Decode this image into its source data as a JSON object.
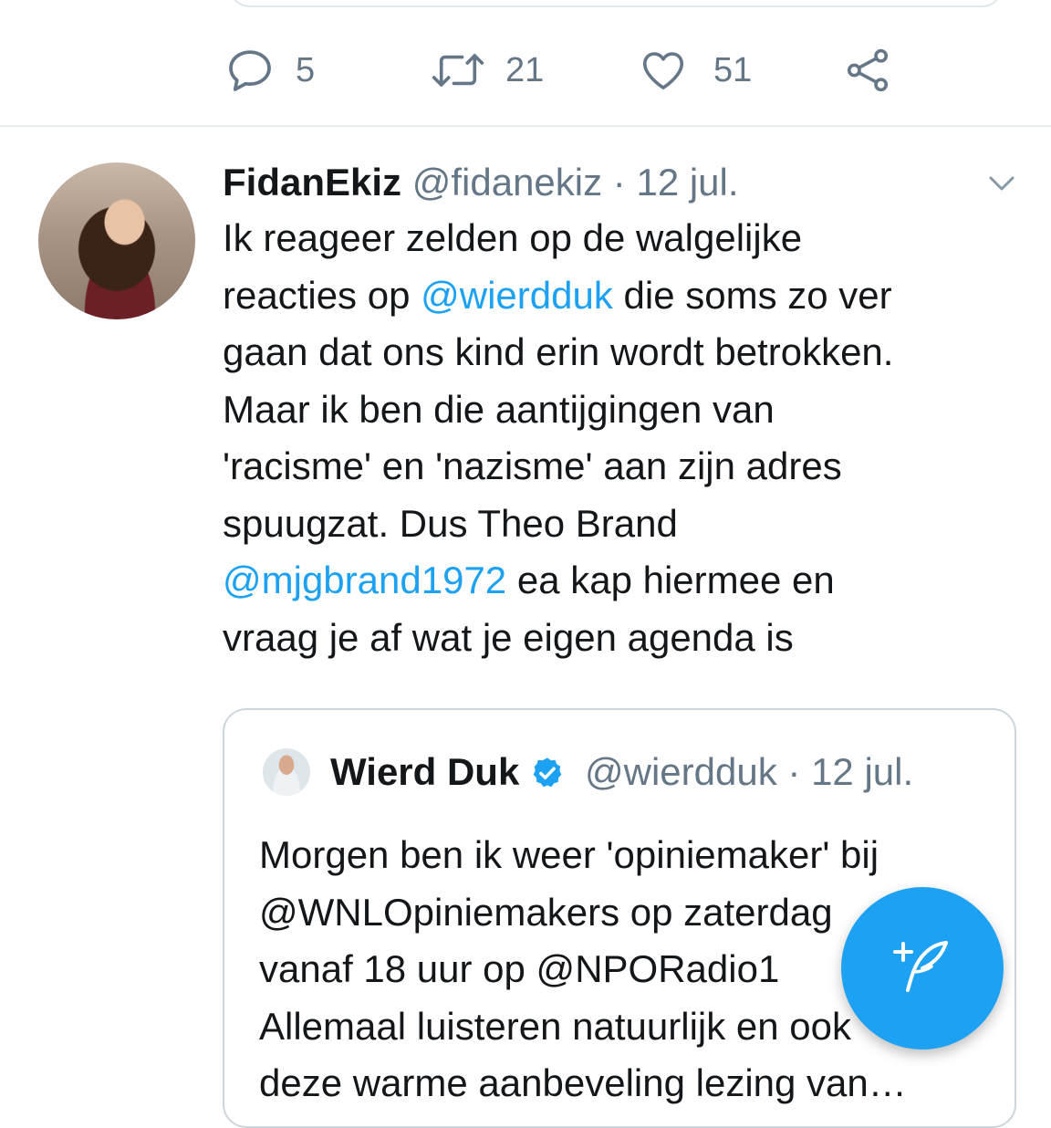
{
  "previous_tweet": {
    "actions": {
      "reply_count": "5",
      "retweet_count": "21",
      "like_count": "51"
    }
  },
  "tweet": {
    "author_name": "FidanEkiz",
    "author_handle": "@fidanekiz",
    "separator": "·",
    "date": "12 jul.",
    "text_segments": {
      "l1": "Ik reageer zelden op de walgelijke",
      "l2a": "reacties op ",
      "mention1": "@wierdduk",
      "l2b": " die soms zo ver",
      "l3": "gaan dat ons kind erin wordt betrokken.",
      "l4": "Maar ik ben die aantijgingen van",
      "l5": "'racisme' en 'nazisme' aan zijn adres",
      "l6": "spuugzat. Dus Theo Brand",
      "mention2": "@mjgbrand1972",
      "l7b": " ea kap hiermee en",
      "l8": "vraag je af wat je eigen agenda is"
    }
  },
  "quoted_tweet": {
    "author_name": "Wierd Duk",
    "author_handle": "@wierdduk",
    "separator": "·",
    "date": "12 jul.",
    "lines": [
      "Morgen ben ik weer 'opiniemaker' bij",
      "@WNLOpiniemakers op zaterdag",
      "vanaf 18 uur op @NPORadio1",
      "Allemaal luisteren natuurlijk en ook",
      "deze warme aanbeveling lezing van…"
    ]
  },
  "icons": {
    "reply": "reply-icon",
    "retweet": "retweet-icon",
    "like": "heart-icon",
    "share": "share-icon",
    "menu": "chevron-down-icon",
    "verified": "verified-badge-icon",
    "compose": "compose-tweet-icon"
  },
  "colors": {
    "accent": "#1da1f2",
    "secondary_text": "#657786",
    "primary_text": "#14171a"
  }
}
